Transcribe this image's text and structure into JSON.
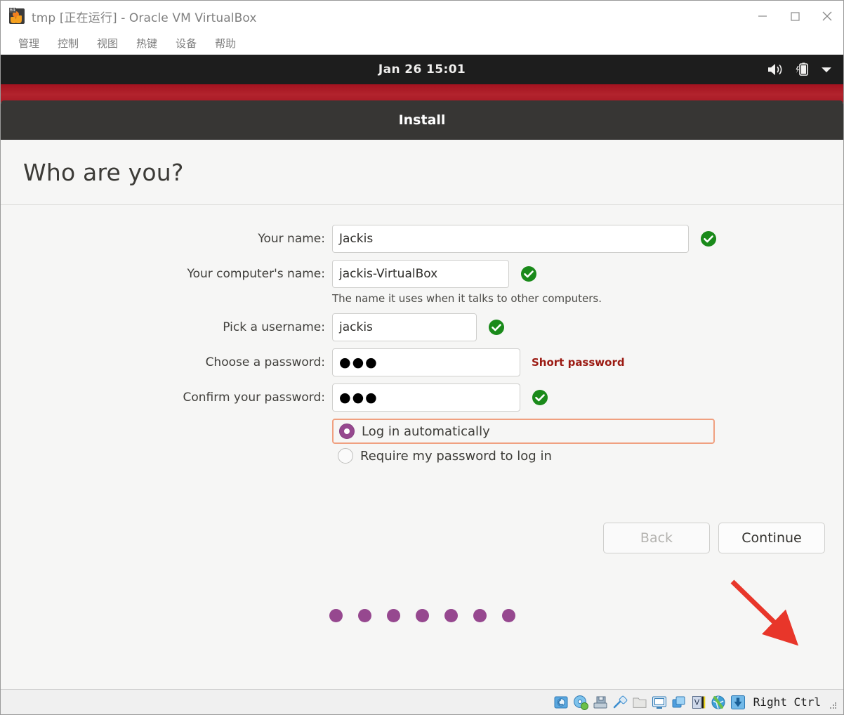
{
  "window": {
    "title": "tmp [正在运行] - Oracle VM VirtualBox",
    "icon": "virtualbox-vm-icon",
    "controls": {
      "minimize": "minimize-icon",
      "maximize": "maximize-icon",
      "close": "close-icon"
    },
    "menu": [
      {
        "label": "管理"
      },
      {
        "label": "控制"
      },
      {
        "label": "视图"
      },
      {
        "label": "热键"
      },
      {
        "label": "设备"
      },
      {
        "label": "帮助"
      }
    ]
  },
  "guest": {
    "topbar": {
      "clock": "Jan 26  15:01",
      "tray": [
        {
          "icon": "volume-icon"
        },
        {
          "icon": "battery-charging-icon"
        },
        {
          "icon": "chevron-down-icon"
        }
      ]
    },
    "header_title": "Install",
    "page_title": "Who are you?",
    "form": {
      "fields": [
        {
          "label": "Your name:",
          "value": "Jackis",
          "status": "valid",
          "status_icon": "green-check-icon"
        },
        {
          "label": "Your computer's name:",
          "value": "jackis-VirtualBox",
          "status": "valid",
          "status_icon": "green-check-icon",
          "hint": "The name it uses when it talks to other computers."
        },
        {
          "label": "Pick a username:",
          "value": "jackis",
          "status": "valid",
          "status_icon": "green-check-icon"
        },
        {
          "label": "Choose a password:",
          "value": "●●●",
          "status": "warning",
          "warning": "Short password"
        },
        {
          "label": "Confirm your password:",
          "value": "●●●",
          "status": "valid",
          "status_icon": "green-check-icon"
        }
      ],
      "login_options": [
        {
          "label": "Log in automatically",
          "selected": true,
          "focused": true
        },
        {
          "label": "Require my password to log in",
          "selected": false,
          "focused": false
        }
      ]
    },
    "buttons": {
      "back": "Back",
      "continue": "Continue"
    },
    "progress_dots": 7,
    "annotation": {
      "type": "red-arrow",
      "points_to": "Continue"
    }
  },
  "statusbar": {
    "icons": [
      {
        "name": "hard-disk-icon"
      },
      {
        "name": "optical-disk-icon"
      },
      {
        "name": "floppy-disk-icon"
      },
      {
        "name": "usb-icon"
      },
      {
        "name": "shared-folders-icon"
      },
      {
        "name": "display-icon"
      },
      {
        "name": "video-capture-icon"
      },
      {
        "name": "vrde-server-icon"
      },
      {
        "name": "network-icon"
      },
      {
        "name": "mouse-integration-icon"
      }
    ],
    "host_key": "Right Ctrl"
  },
  "colors": {
    "ubuntu_topbar": "#1d1d1d",
    "ubuntu_red": "#a81a25",
    "install_bar": "#373634",
    "radio_purple": "#96488f",
    "focus_outline": "#f0a080",
    "green_check": "#1a8a1a",
    "warning_red": "#9b1a12",
    "annotation_red": "#e8362a"
  }
}
